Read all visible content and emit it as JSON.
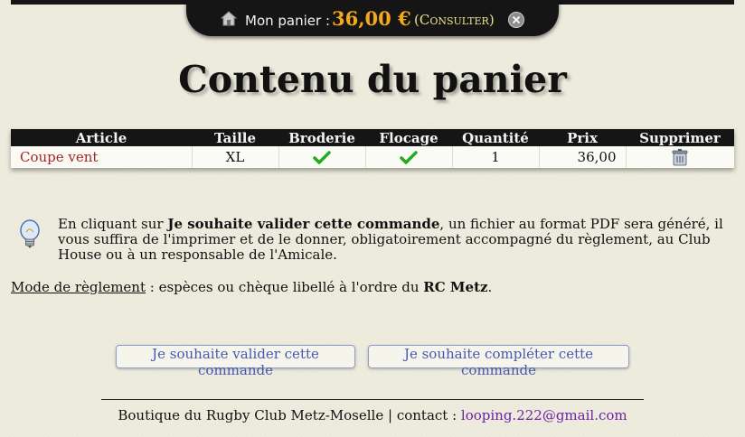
{
  "cart_bar": {
    "label": "Mon panier :",
    "amount": "36,00 €",
    "consult_link": "(Consulter)",
    "icons": {
      "home": "home-icon",
      "close": "close-circle-icon"
    }
  },
  "page_title": "Contenu du panier",
  "table": {
    "headers": [
      "Article",
      "Taille",
      "Broderie",
      "Flocage",
      "Quantité",
      "Prix",
      "Supprimer"
    ],
    "rows": [
      {
        "article": "Coupe vent",
        "taille": "XL",
        "broderie_icon": "checkmark-icon",
        "flocage_icon": "checkmark-icon",
        "quantite": "1",
        "prix": "36,00",
        "supprimer_icon": "trash-icon"
      }
    ]
  },
  "notice": {
    "icon": "lightbulb-icon",
    "intro": "En cliquant sur ",
    "bold": "Je souhaite valider cette commande",
    "rest": ", un fichier au format PDF sera généré, il vous suffira de l'imprimer et de le donner, obligatoirement accompagné du règlement, au Club House ou à un responsable de l'Amicale."
  },
  "payment": {
    "label": "Mode de règlement",
    "text": " : espèces ou chèque libellé à l'ordre du ",
    "payee": "RC Metz",
    "end": "."
  },
  "buttons": {
    "validate": "Je souhaite valider cette commande",
    "complete": "Je souhaite compléter cette commande"
  },
  "footer": {
    "text": "Boutique du Rugby Club Metz-Moselle | contact : ",
    "email": "looping.222@gmail.com"
  },
  "colors": {
    "background": "#ebe9d9",
    "bar": "#151515",
    "amount": "#f4a91a",
    "consult": "#ece38a",
    "article": "#a82424",
    "button_text": "#4657b4",
    "check": "#22aa22",
    "email": "#6d1fa8"
  }
}
